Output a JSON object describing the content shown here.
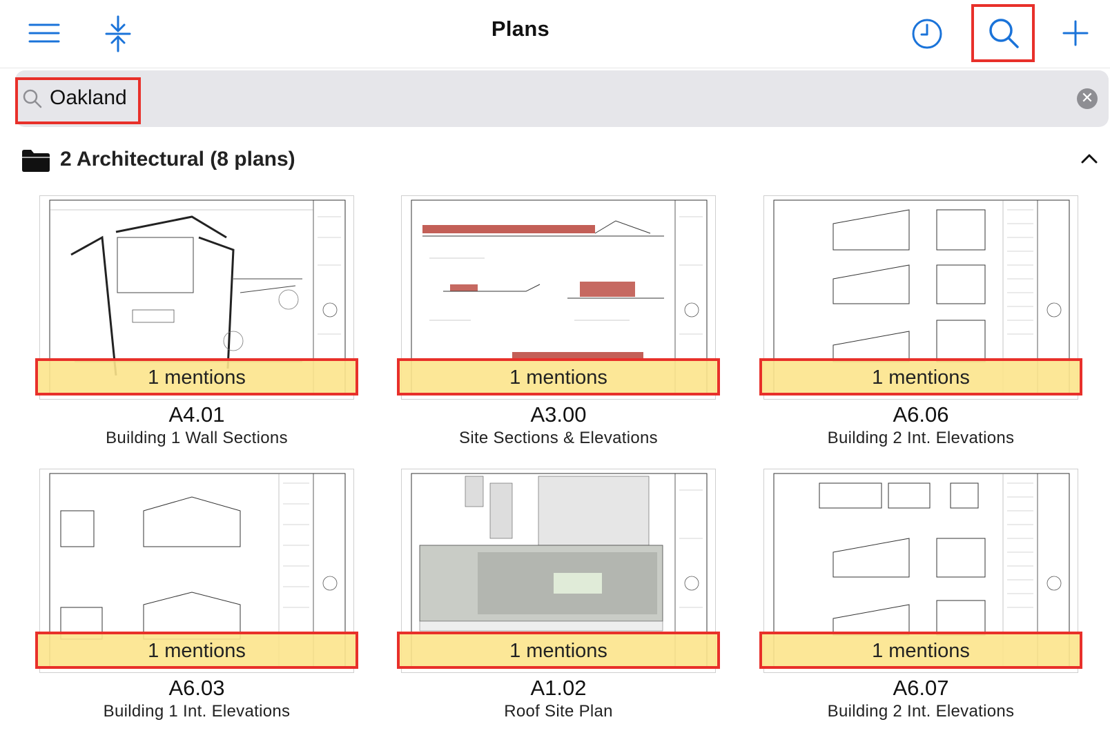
{
  "colors": {
    "accent": "#1a73d9",
    "annotation_red": "#e8302a",
    "highlight_yellow": "#fce48c",
    "search_bg": "#e6e6ea"
  },
  "navbar": {
    "title": "Plans",
    "icons": [
      "menu-icon",
      "collapse-all-icon",
      "history-icon",
      "search-icon",
      "add-icon"
    ]
  },
  "search": {
    "value": "Oakland",
    "clear_icon": "close-circle-icon"
  },
  "section": {
    "title": "2 Architectural (8 plans)",
    "icon": "folder-icon",
    "toggle_icon": "chevron-up-icon"
  },
  "plans": [
    {
      "number": "A4.01",
      "name": "Building 1 Wall Sections",
      "mentions": "1 mentions"
    },
    {
      "number": "A3.00",
      "name": "Site Sections & Elevations",
      "mentions": "1 mentions"
    },
    {
      "number": "A6.06",
      "name": "Building 2 Int. Elevations",
      "mentions": "1 mentions"
    },
    {
      "number": "A6.03",
      "name": "Building 1 Int. Elevations",
      "mentions": "1 mentions"
    },
    {
      "number": "A1.02",
      "name": "Roof Site Plan",
      "mentions": "1 mentions"
    },
    {
      "number": "A6.07",
      "name": "Building 2 Int. Elevations",
      "mentions": "1 mentions"
    }
  ]
}
